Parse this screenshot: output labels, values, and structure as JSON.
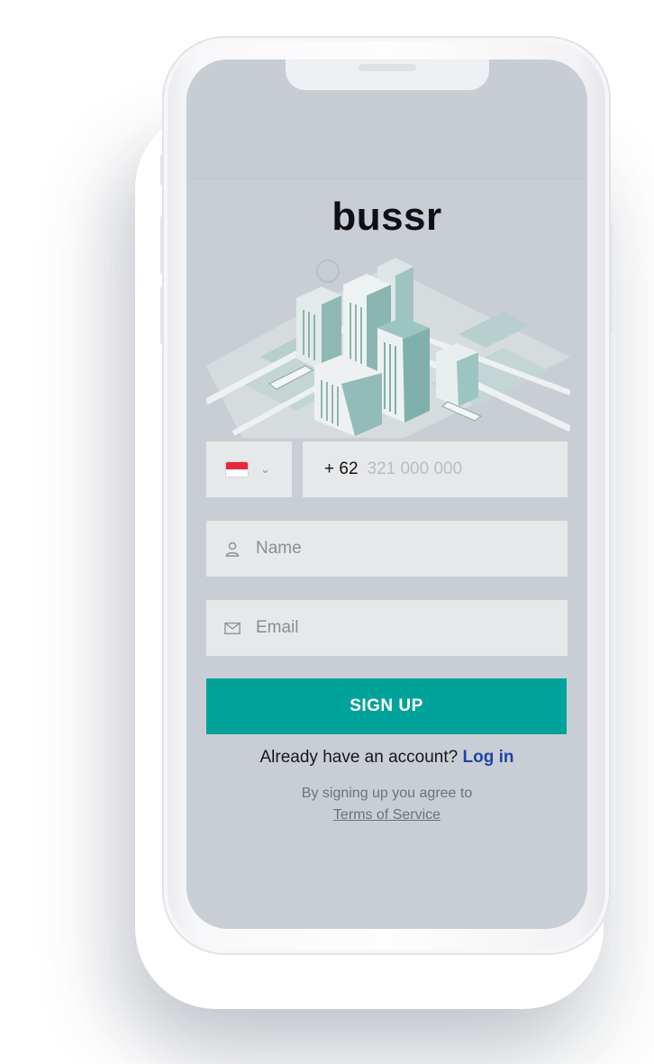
{
  "app": {
    "brand": "bussr"
  },
  "phone_input": {
    "country_flag": "indonesia-flag",
    "dropdown_icon": "chevron-down-icon",
    "country_code": "+ 62",
    "placeholder": "321 000 000"
  },
  "name_input": {
    "icon": "person-icon",
    "placeholder": "Name"
  },
  "email_input": {
    "icon": "envelope-icon",
    "placeholder": "Email"
  },
  "signup_button": {
    "label": "SIGN UP"
  },
  "login_prompt": {
    "text": "Already have an account?",
    "link": "Log in"
  },
  "terms": {
    "text": "By signing up you agree to",
    "link": "Terms of Service"
  },
  "colors": {
    "accent": "#00a39a",
    "link": "#1c46a8",
    "screen_bg": "#c9ced4",
    "field_bg": "#e7e8ea"
  }
}
